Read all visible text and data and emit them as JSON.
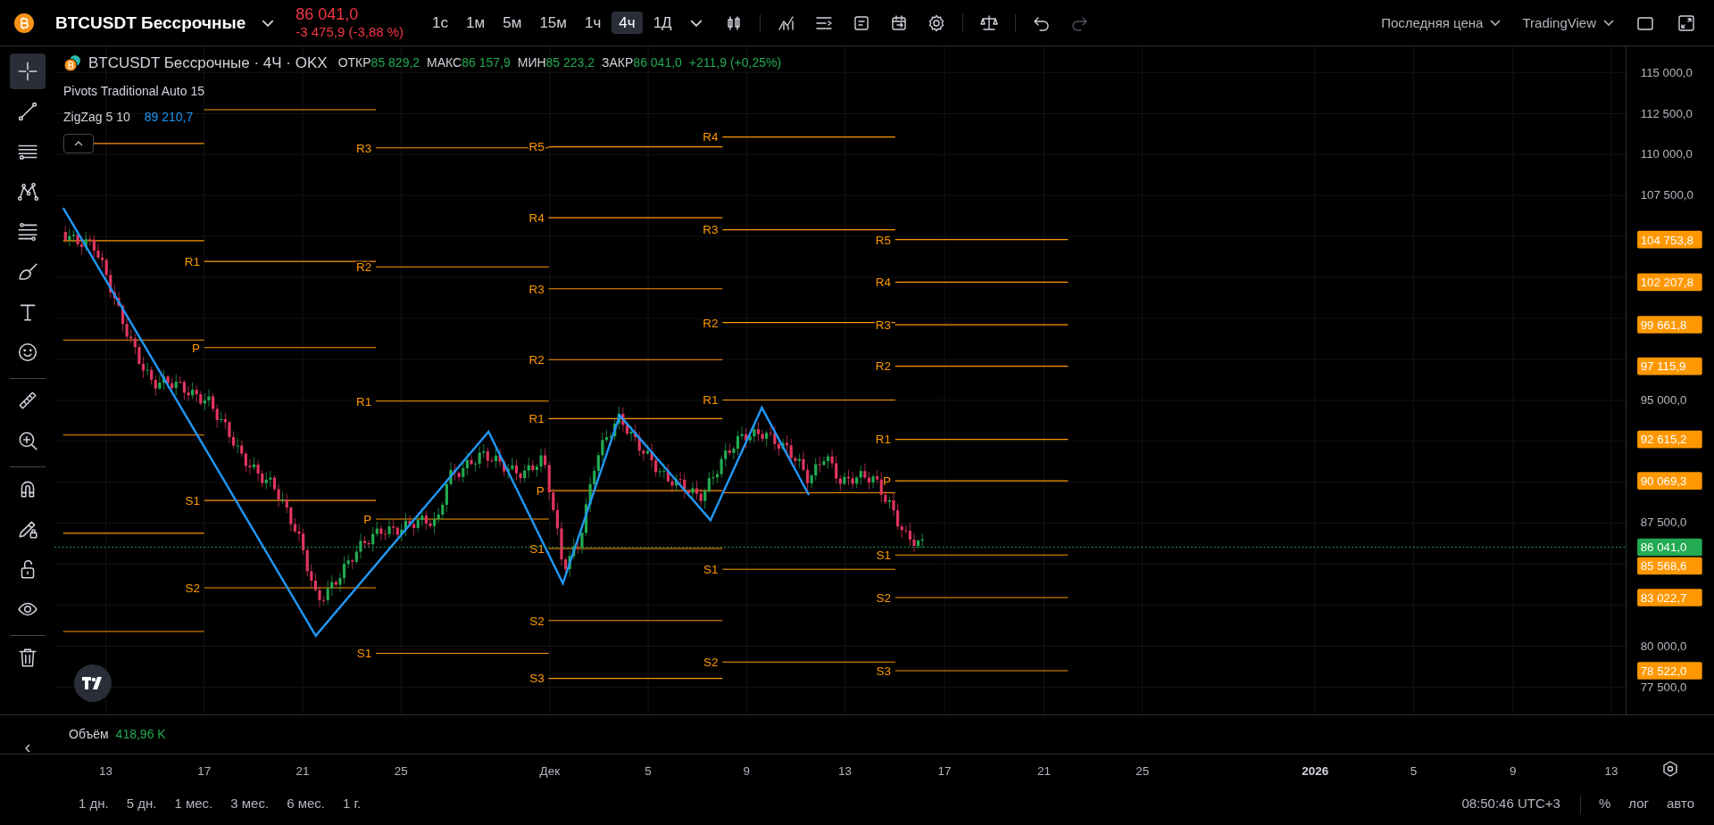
{
  "header": {
    "symbol": "BTCUSDT Бессрочные",
    "price": "86 041,0",
    "change": "-3 475,9 (-3,88 %)"
  },
  "intervals": [
    {
      "label": "1с",
      "selected": false
    },
    {
      "label": "1м",
      "selected": false
    },
    {
      "label": "5м",
      "selected": false
    },
    {
      "label": "15м",
      "selected": false
    },
    {
      "label": "1ч",
      "selected": false
    },
    {
      "label": "4ч",
      "selected": true
    },
    {
      "label": "1Д",
      "selected": false
    }
  ],
  "undo": {
    "disabled": false
  },
  "redo": {
    "disabled": true
  },
  "price_source": "Последняя цена",
  "theme_menu": "TradingView",
  "left_toolbar": [
    {
      "selected": true
    },
    {
      "selected": false
    },
    {
      "selected": false
    },
    {
      "selected": false
    },
    {
      "selected": false
    },
    {
      "selected": false
    },
    {
      "selected": false
    },
    {
      "selected": false
    },
    {
      "selected": false
    },
    {
      "selected": false
    },
    {
      "selected": false
    },
    {
      "selected": false
    },
    {
      "selected": false
    },
    {
      "selected": false
    },
    {
      "selected": false
    }
  ],
  "legend": {
    "title": "BTCUSDT Бессрочные · 4Ч · OKX",
    "ohlc": [
      {
        "label": "ОТКР",
        "value": "85 829,2"
      },
      {
        "label": "МАКС",
        "value": "86 157,9"
      },
      {
        "label": "МИН",
        "value": "85 223,2"
      },
      {
        "label": "ЗАКР",
        "value": "86 041,0"
      }
    ],
    "change": "+211,9 (+0,25%)",
    "indicators": [
      {
        "name": "Pivots Traditional Auto 15"
      },
      {
        "name": "ZigZag 5 10",
        "value": "89 210,7"
      }
    ]
  },
  "pivot_periods": [
    {
      "levels": [
        "R1",
        "P",
        "S1",
        "S2"
      ]
    },
    {
      "levels": [
        "R3",
        "R2",
        "R1",
        "P",
        "S1"
      ]
    },
    {
      "levels": [
        "R5",
        "R4",
        "R3",
        "R2",
        "R1",
        "P",
        "S1",
        "S2",
        "S3"
      ]
    },
    {
      "levels": [
        "R4",
        "R3",
        "R2",
        "R1",
        "S1",
        "S2"
      ]
    },
    {
      "levels": [
        "R5",
        "R4",
        "R3",
        "R2",
        "R1",
        "P",
        "S1",
        "S2",
        "S3"
      ]
    }
  ],
  "price_axis": {
    "ticks": [
      "115 000,0",
      "112 500,0",
      "110 000,0",
      "107 500,0",
      "95 000,0",
      "87 500,0",
      "80 000,0",
      "77 500,0"
    ],
    "level_labels": [
      "104 753,8",
      "102 207,8",
      "99 661,8",
      "97 115,9",
      "92 615,2",
      "90 069,3",
      "85 568,6",
      "83 022,7",
      "78 522,0"
    ],
    "last_price": "86 041,0"
  },
  "volume": {
    "label": "Объём",
    "value": "418,96 K"
  },
  "time_axis": [
    {
      "label": "13",
      "bold": false
    },
    {
      "label": "17",
      "bold": false
    },
    {
      "label": "21",
      "bold": false
    },
    {
      "label": "25",
      "bold": false
    },
    {
      "label": "Дек",
      "bold": false
    },
    {
      "label": "5",
      "bold": false
    },
    {
      "label": "9",
      "bold": false
    },
    {
      "label": "13",
      "bold": false
    },
    {
      "label": "17",
      "bold": false
    },
    {
      "label": "21",
      "bold": false
    },
    {
      "label": "25",
      "bold": false
    },
    {
      "label": "2026",
      "bold": true
    },
    {
      "label": "5",
      "bold": false
    },
    {
      "label": "9",
      "bold": false
    },
    {
      "label": "13",
      "bold": false
    }
  ],
  "ranges": [
    "1 дн.",
    "5 дн.",
    "1 мес.",
    "3 мес.",
    "6 мес.",
    "1 г."
  ],
  "status": {
    "time": "08:50:46 UTC+3",
    "percent": "%",
    "log": "лог",
    "auto": "авто"
  }
}
